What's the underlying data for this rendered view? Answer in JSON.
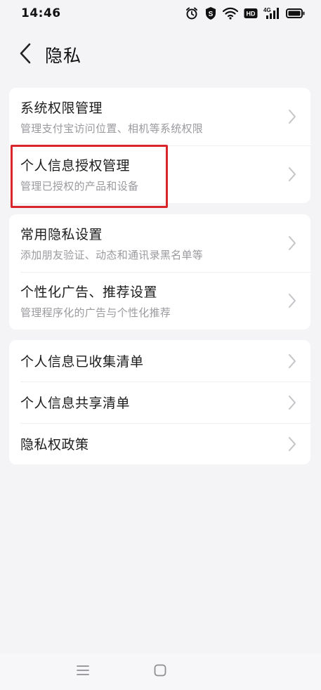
{
  "status_bar": {
    "time": "14:46",
    "icons": [
      "alarm-icon",
      "shield-s-icon",
      "wifi-icon",
      "hd-icon",
      "signal-4g-icon",
      "battery-icon"
    ],
    "hd_label": "HD",
    "network_label": "4G"
  },
  "header": {
    "back_icon": "chevron-left-icon",
    "title": "隐私"
  },
  "groups": [
    {
      "items": [
        {
          "title": "系统权限管理",
          "subtitle": "管理支付宝访问位置、相机等系统权限"
        },
        {
          "title": "个人信息授权管理",
          "subtitle": "管理已授权的产品和设备",
          "highlighted": true
        }
      ]
    },
    {
      "items": [
        {
          "title": "常用隐私设置",
          "subtitle": "添加朋友验证、动态和通讯录黑名单等"
        },
        {
          "title": "个性化广告、推荐设置",
          "subtitle": "管理程序化的广告与个性化推荐"
        }
      ]
    },
    {
      "items": [
        {
          "title": "个人信息已收集清单"
        },
        {
          "title": "个人信息共享清单"
        },
        {
          "title": "隐私权政策"
        }
      ]
    }
  ],
  "nav_bar": {
    "icons": [
      "menu-icon",
      "home-icon"
    ]
  },
  "colors": {
    "background": "#f4f4f6",
    "card": "#ffffff",
    "highlight_border": "#d8262c",
    "subtitle": "#9a9a9f",
    "chevron": "#c4c4c8"
  }
}
